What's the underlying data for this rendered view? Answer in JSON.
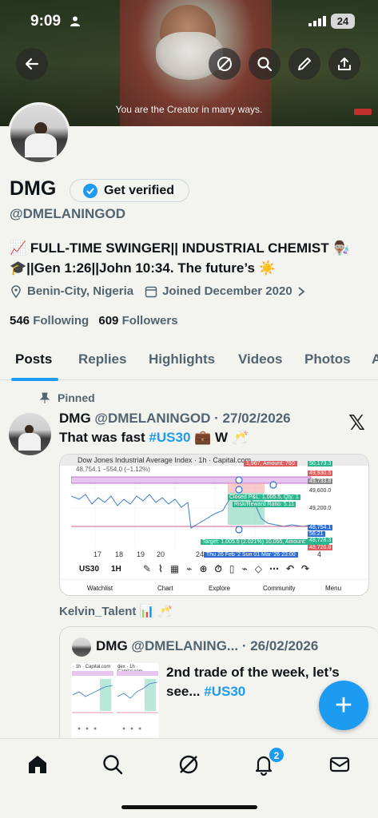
{
  "status": {
    "time": "9:09",
    "battery": "24"
  },
  "banner": {
    "caption": "You are the Creator in many ways."
  },
  "profile": {
    "name": "DMG",
    "get_verified": "Get verified",
    "handle": "@DMELANINGOD",
    "bio_line1": "📈 FULL-TIME SWINGER|| INDUSTRIAL CHEMIST 👨🏽‍🔬",
    "bio_line2": "🎓||Gen 1:26||John 10:34. The future’s ☀️",
    "location": "Benin-City, Nigeria",
    "joined": "Joined December 2020",
    "following_count": "546",
    "following_label": "Following",
    "followers_count": "609",
    "followers_label": "Followers"
  },
  "tabs": [
    "Posts",
    "Replies",
    "Highlights",
    "Videos",
    "Photos",
    "A"
  ],
  "post": {
    "pinned_label": "Pinned",
    "author": "DMG",
    "handle_date": "@DMELANINGOD · 27/02/2026",
    "text_before": "That was fast ",
    "hashtag": "#US30",
    "text_after": " 💼 W 🥂",
    "chart": {
      "title": "Dow Jones Industrial Average Index · 1h · Capital.com",
      "sub": "48,754.1 −554.0 (−1.12%)",
      "closed": "Closed P&L: 1,005.5, Qty: 1",
      "rr": "Risk/Reward Ratio: 5.11",
      "target": "Target: 1,005.5 (2.021%) 10,055, Amount: 2277.00",
      "dates": "Thu 26 Feb '2   Sun 01 Mar '26   23:00",
      "prices": [
        "50,173.3",
        "49,930.5",
        "49,733.8",
        "49,600.0",
        "49,200.0",
        "48,754.1",
        "56:21",
        "48,728.3",
        "48,726.8"
      ],
      "amount": "1,967, Amount: 760",
      "xticks": [
        "17",
        "18",
        "19",
        "20",
        "24",
        "4"
      ],
      "symbol": "US30",
      "interval": "1H",
      "nav": [
        "Watchlist",
        "Chart",
        "Explore",
        "Community",
        "Menu"
      ]
    }
  },
  "repost_by": "Kelvin_Talent 📊 🥂",
  "quote": {
    "author": "DMG",
    "handle_date": "@DMELANING... · 26/02/2026",
    "text_before": "2nd trade of the week, let’s see... ",
    "hashtag": "#US30",
    "thumb1": "· 1h · Capital.com",
    "thumb2": "dex · 1h · Capital.com"
  },
  "fab_label": "+",
  "notifications_badge": "2"
}
